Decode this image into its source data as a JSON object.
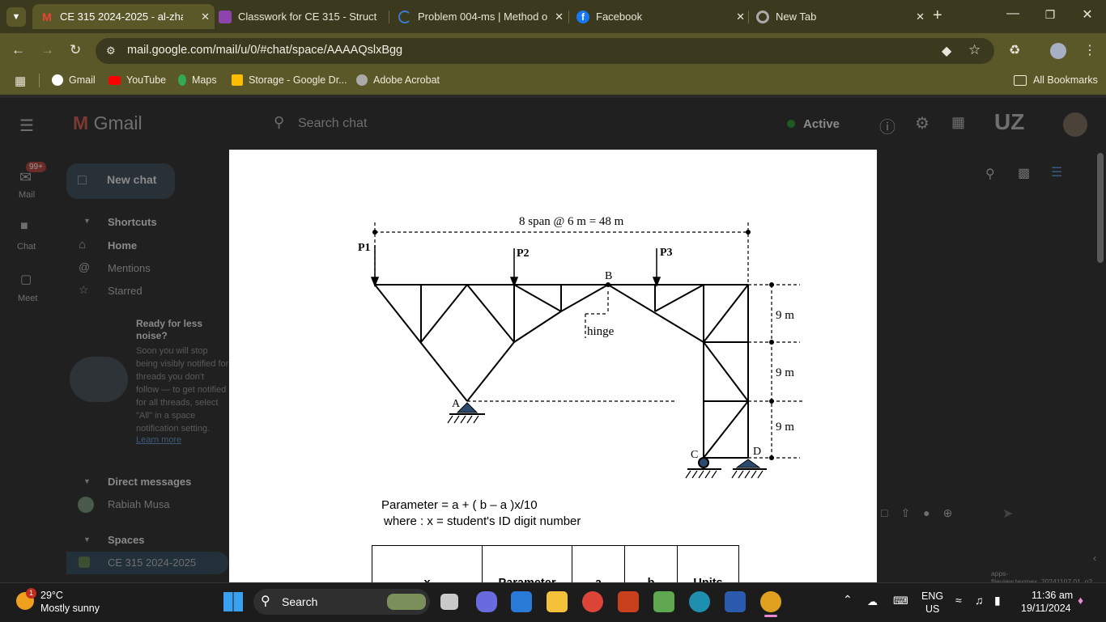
{
  "browser": {
    "tabs": [
      {
        "title": "CE 315 2024-2025 - al-zhada",
        "active": true
      },
      {
        "title": "Classwork for CE 315 - Struct",
        "active": false
      },
      {
        "title": "Problem 004-ms | Method o",
        "active": false
      },
      {
        "title": "Facebook",
        "active": false
      },
      {
        "title": "New Tab",
        "active": false
      }
    ],
    "url": "mail.google.com/mail/u/0/#chat/space/AAAAQslxBgg",
    "bookmarks": [
      "Gmail",
      "YouTube",
      "Maps",
      "Storage - Google Dr...",
      "Adobe Acrobat"
    ],
    "all_bookmarks": "All Bookmarks"
  },
  "gmail": {
    "logo": "Gmail",
    "search_placeholder": "Search chat",
    "status": "Active",
    "badge": "99+",
    "rail": [
      "Mail",
      "Chat",
      "Meet"
    ],
    "new_chat": "New chat",
    "shortcuts_header": "Shortcuts",
    "shortcuts": [
      "Home",
      "Mentions",
      "Starred"
    ],
    "promo_title": "Ready for less noise?",
    "promo_body": "Soon you will stop being visibly notified for threads you don't follow — to get notified for all threads, select \"All\" in a space notification setting.",
    "promo_link": "Learn more",
    "dm_header": "Direct messages",
    "dm_contact": "Rabiah Musa",
    "spaces_header": "Spaces",
    "space_item": "CE 315 2024-2025",
    "footer_note": "apps-fileview.texmex_20241107.01_p2"
  },
  "document": {
    "span_label": "8 span @ 6 m = 48 m",
    "loads": [
      "P1",
      "P2",
      "P3"
    ],
    "node_labels": {
      "a": "A",
      "b": "B",
      "c": "C",
      "d": "D"
    },
    "hinge_label": "hinge",
    "height_labels": [
      "9 m",
      "9 m",
      "9 m"
    ],
    "formula": "Parameter = a + ( b – a )x/10",
    "where": "where : x = student's ID digit number",
    "table_headers": [
      "x",
      "Parameter",
      "a",
      "b",
      "Units"
    ]
  },
  "taskbar": {
    "weather_temp": "29°C",
    "weather_desc": "Mostly sunny",
    "weather_badge": "1",
    "search_label": "Search",
    "lang_top": "ENG",
    "lang_bottom": "US",
    "time": "11:36 am",
    "date": "19/11/2024"
  },
  "colors": {
    "tab_strip": "#3b3a1e",
    "toolbar": "#5a5828",
    "gmail_bg": "#202020",
    "support_fill": "#2c4a6e",
    "active_green": "#2e7d32"
  }
}
